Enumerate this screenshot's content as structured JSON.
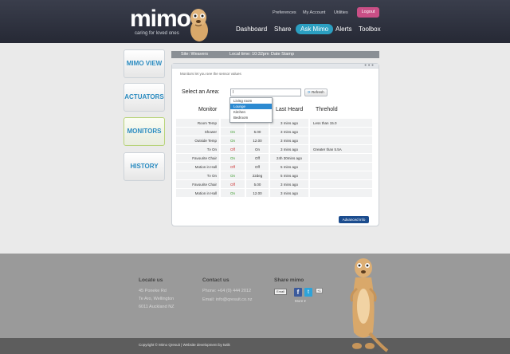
{
  "header": {
    "logo": "mimo",
    "tagline": "caring for loved ones",
    "utility": [
      "Preferences",
      "My Account",
      "Utilities"
    ],
    "logout": "Logout",
    "nav": [
      "Dashboard",
      "Share",
      "Ask Mimo",
      "Alerts",
      "Toolbox"
    ],
    "active_nav": "Ask Mimo"
  },
  "sidebar": {
    "tabs": [
      "MIMO VIEW",
      "ACTUATORS",
      "MONITORS",
      "HISTORY"
    ],
    "active": "MONITORS"
  },
  "statusbar": {
    "site": "Site: Weavers",
    "local_time": "Local time: 10:32pm",
    "date": "Date Stamp"
  },
  "panel": {
    "subtitle": "Monitors let you see the sensor values",
    "select_label": "Select an Area:",
    "input_value": "l",
    "refresh": "Refresh",
    "dropdown": [
      "Living room",
      "Lounge",
      "Kitchen",
      "Bedroom"
    ],
    "dropdown_selected": "Lounge",
    "columns": [
      "Monitor",
      "",
      "",
      "Last Heard",
      "Threhold"
    ],
    "rows": [
      {
        "name": "Room Temp",
        "state": "",
        "value": "",
        "heard": "3 mins ago",
        "threshold": "Less than 15.0"
      },
      {
        "name": "Shower",
        "state": "On",
        "value": "5.00",
        "heard": "3 mins ago",
        "threshold": ""
      },
      {
        "name": "Outside Temp",
        "state": "On",
        "value": "12.00",
        "heard": "3 mins ago",
        "threshold": ""
      },
      {
        "name": "Tv On",
        "state": "Off",
        "value": "On",
        "heard": "3 mins ago",
        "threshold": "Greater than 5.5A"
      },
      {
        "name": "Favourite Chair",
        "state": "On",
        "value": "Off",
        "heard": "24h 30mins ago",
        "threshold": ""
      },
      {
        "name": "Motion in Hall",
        "state": "Off",
        "value": "Off",
        "heard": "5 mins ago",
        "threshold": ""
      },
      {
        "name": "Tv On",
        "state": "On",
        "value": "22deg",
        "heard": "5 mins ago",
        "threshold": ""
      },
      {
        "name": "Favourite Chair",
        "state": "Off",
        "value": "5.00",
        "heard": "3 mins ago",
        "threshold": ""
      },
      {
        "name": "Motion in Hall",
        "state": "On",
        "value": "12.00",
        "heard": "3 mins ago",
        "threshold": ""
      }
    ],
    "advanced": "Advanced Info"
  },
  "footer": {
    "locate_title": "Locate us",
    "locate_lines": [
      "45 Poneke Rd",
      "Te Aro, Wellington",
      "6011 Auckland NZ"
    ],
    "contact_title": "Contact us",
    "phone": "Phone: +64 (0) 444 2012",
    "email": "Email: info@qresuit.co.nz",
    "share_title": "Share mimo",
    "email_btn": "Email",
    "more": "More",
    "copyright": "Copyright © Mimo Qresuit | Website development by twiik"
  },
  "colors": {
    "accent": "#2b9fc1",
    "logout": "#c94f86",
    "advanced": "#1b4c8e",
    "on": "#3a9a2a",
    "off": "#cc2a2a"
  }
}
